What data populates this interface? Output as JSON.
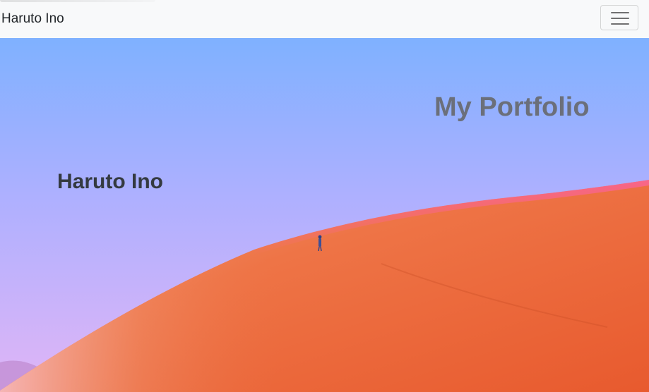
{
  "navbar": {
    "brand": "Haruto Ino",
    "toggler_icon": "hamburger-menu-icon"
  },
  "hero": {
    "title": "My Portfolio",
    "name": "Haruto Ino",
    "colors": {
      "sky_top": "#7fb1ff",
      "sky_bottom": "#d9b2f5",
      "dune": "#ec6a3a",
      "dune_edge": "#ff5fb4"
    }
  }
}
